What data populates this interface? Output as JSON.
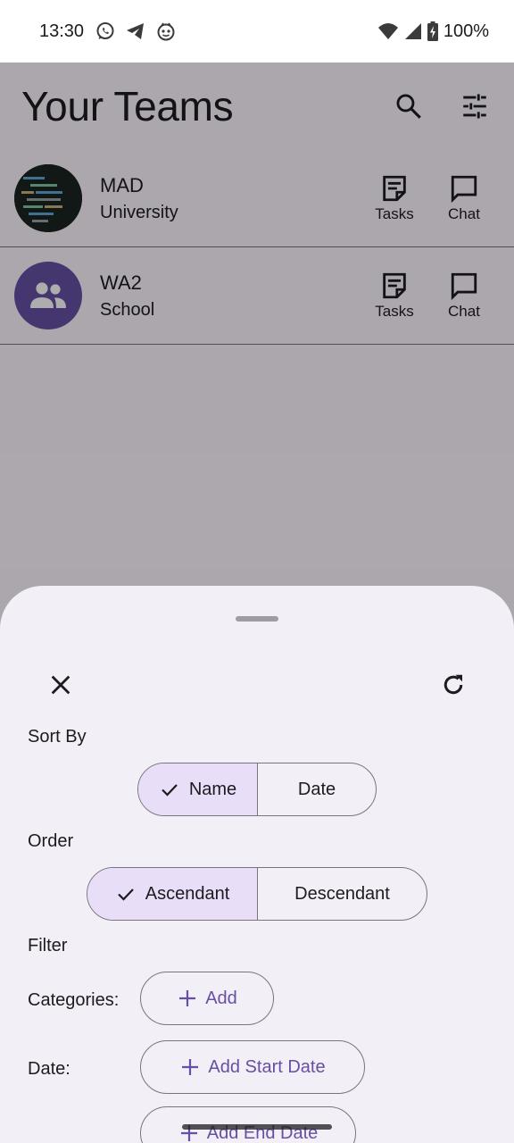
{
  "status_bar": {
    "time": "13:30",
    "battery": "100%",
    "left_icons": [
      "whatsapp-icon",
      "telegram-icon",
      "robot-icon"
    ],
    "right_icons": [
      "wifi-icon",
      "cell-signal-icon",
      "battery-charging-icon"
    ]
  },
  "top_bar": {
    "title": "Your Teams",
    "actions": [
      "search-icon",
      "tune-icon"
    ]
  },
  "teams": [
    {
      "name": "MAD",
      "category": "University",
      "avatar": "code-image",
      "actions": [
        {
          "label": "Tasks",
          "icon": "sticky-note-icon"
        },
        {
          "label": "Chat",
          "icon": "chat-bubble-icon"
        }
      ]
    },
    {
      "name": "WA2",
      "category": "School",
      "avatar": "group-icon",
      "actions": [
        {
          "label": "Tasks",
          "icon": "sticky-note-icon"
        },
        {
          "label": "Chat",
          "icon": "chat-bubble-icon"
        }
      ]
    }
  ],
  "sheet": {
    "sort_by_label": "Sort By",
    "sort_options": [
      {
        "label": "Name",
        "selected": true
      },
      {
        "label": "Date",
        "selected": false
      }
    ],
    "order_label": "Order",
    "order_options": [
      {
        "label": "Ascendant",
        "selected": true
      },
      {
        "label": "Descendant",
        "selected": false
      }
    ],
    "filter_label": "Filter",
    "categories_label": "Categories:",
    "add_label": "Add",
    "date_label": "Date:",
    "add_start_date_label": "Add Start Date",
    "add_end_date_label": "Add End Date"
  },
  "colors": {
    "primary": "#6750a4",
    "selected_segment": "#e8def8",
    "sheet_bg": "#f3eff6",
    "outline": "#79747e"
  }
}
